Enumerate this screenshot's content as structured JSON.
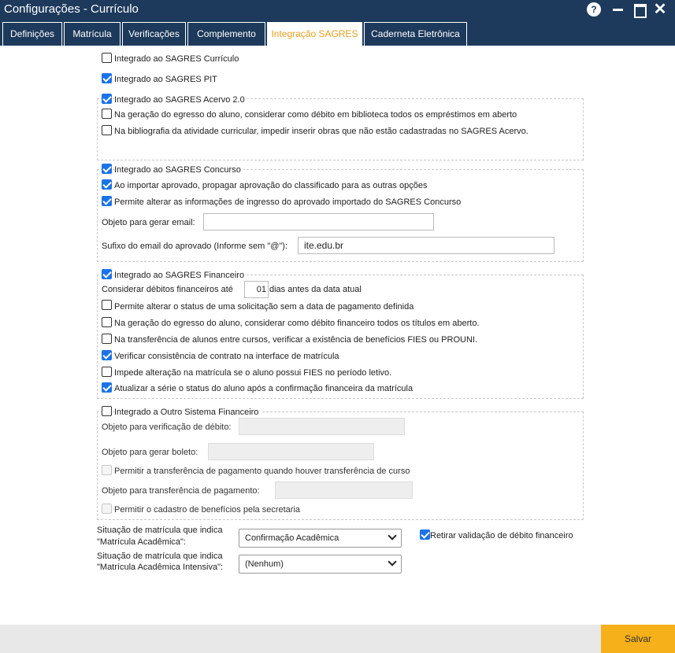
{
  "window": {
    "title": "Configurações - Currículo",
    "help_glyph": "?",
    "close_glyph": "✕"
  },
  "tabs": [
    {
      "label": "Definições"
    },
    {
      "label": "Matrícula"
    },
    {
      "label": "Verificações"
    },
    {
      "label": "Complemento"
    },
    {
      "label": "Integração SAGRES"
    },
    {
      "label": "Caderneta Eletrônica"
    }
  ],
  "active_tab": "Integração SAGRES",
  "curriculo": {
    "label": "Integrado ao SAGRES Currículo",
    "checked": false
  },
  "pit": {
    "label": "Integrado ao SAGRES PIT",
    "checked": true
  },
  "acervo": {
    "label": "Integrado ao SAGRES Acervo 2.0",
    "checked": true,
    "options": [
      {
        "label": "Na geração do egresso do aluno, considerar como débito em biblioteca todos os empréstimos em aberto",
        "checked": false
      },
      {
        "label": "Na bibliografia da atividade curricular, impedir inserir obras que não estão cadastradas no SAGRES Acervo.",
        "checked": false
      }
    ]
  },
  "concurso": {
    "label": "Integrado ao SAGRES Concurso",
    "checked": true,
    "options": [
      {
        "label": "Ao importar aprovado, propagar aprovação do classificado para as outras opções",
        "checked": true
      },
      {
        "label": "Permite alterar as informações de ingresso do aprovado importado do SAGRES Concurso",
        "checked": true
      }
    ],
    "email_object_label": "Objeto para gerar email:",
    "email_object_value": "",
    "suffix_label": "Sufixo do email do aprovado (Informe sem \"@\"):",
    "suffix_value": "ite.edu.br"
  },
  "financeiro": {
    "label": "Integrado ao SAGRES Financeiro",
    "checked": true,
    "debitos_prefix": "Considerar débitos financeiros até",
    "debitos_value": "01",
    "debitos_suffix": "dias antes da data atual",
    "options": [
      {
        "label": "Permite alterar o status de uma solicitação sem a data de pagamento definida",
        "checked": false
      },
      {
        "label": "Na geração do egresso do aluno, considerar como débito financeiro todos os títulos em aberto.",
        "checked": false
      },
      {
        "label": "Na transferência de alunos entre cursos, verificar a existência de benefícios FIES ou PROUNI.",
        "checked": false
      },
      {
        "label": "Verificar consistência de contrato na interface de matrícula",
        "checked": true
      },
      {
        "label": "Impede alteração na matrícula se o aluno possui FIES no período letivo.",
        "checked": false
      },
      {
        "label": "Atualizar a série o status do aluno após a confirmação financeira da matrícula",
        "checked": true
      }
    ]
  },
  "outro": {
    "label": "Integrado a Outro Sistema Financeiro",
    "checked": false,
    "verificacao_label": "Objeto para verificação de débito:",
    "boleto_label": "Objeto para gerar boleto:",
    "transferencia_cb_label": "Permitir a transferência de pagamento quando houver transferência de curso",
    "transferencia_label": "Objeto para transferência de pagamento:",
    "beneficios_cb_label": "Permitir o cadastro de benefícios pela secretaria"
  },
  "situacao_academica": {
    "label_line1": "Situação de matrícula que indica",
    "label_line2": "\"Matrícula Acadêmica\":",
    "selected": "Confirmação Acadêmica"
  },
  "situacao_intensiva": {
    "label_line1": "Situação de matrícula que indica",
    "label_line2": "\"Matrícula Acadêmica Intensiva\":",
    "selected": "(Nenhum)"
  },
  "retirar_validacao": {
    "label": "Retirar validação de débito financeiro",
    "checked": true
  },
  "footer": {
    "save_label": "Salvar"
  },
  "colors": {
    "titlebar": "#1d3a5c",
    "active_tab_text": "#e8a020",
    "save_button": "#f5b01a",
    "checkbox_checked": "#1a73e8"
  }
}
